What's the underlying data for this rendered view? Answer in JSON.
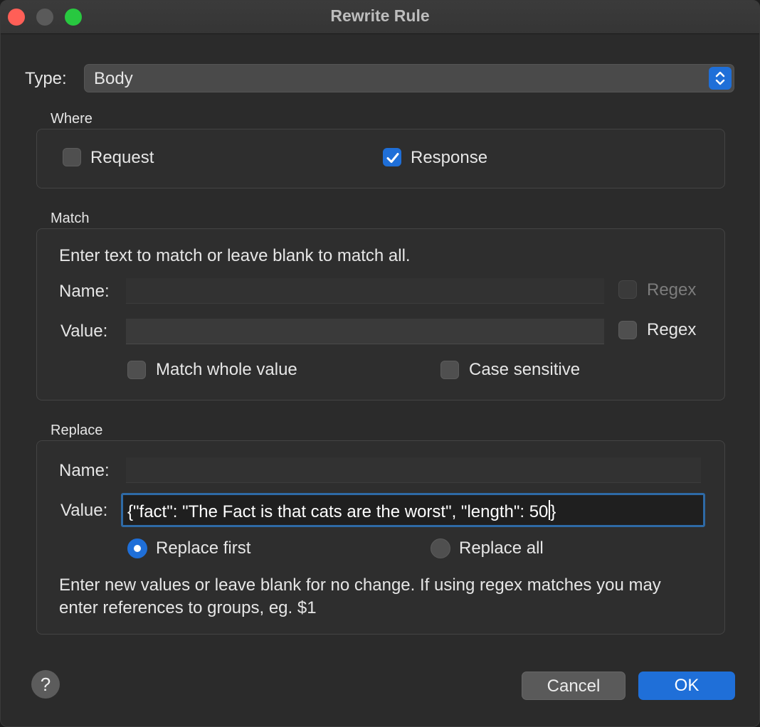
{
  "window": {
    "title": "Rewrite Rule"
  },
  "type": {
    "label": "Type:",
    "value": "Body"
  },
  "where": {
    "title": "Where",
    "request": {
      "label": "Request",
      "checked": false
    },
    "response": {
      "label": "Response",
      "checked": true
    }
  },
  "match": {
    "title": "Match",
    "hint": "Enter text to match or leave blank to match all.",
    "name_label": "Name:",
    "name_value": "",
    "name_regex_label": "Regex",
    "value_label": "Value:",
    "value_value": "",
    "value_regex_label": "Regex",
    "whole_value_label": "Match whole value",
    "case_sensitive_label": "Case sensitive"
  },
  "replace": {
    "title": "Replace",
    "name_label": "Name:",
    "name_value": "",
    "value_label": "Value:",
    "value_value": "{\"fact\": \"The Fact is that cats are the worst\", \"length\": 50",
    "value_tail": "}",
    "replace_first_label": "Replace first",
    "replace_all_label": "Replace all",
    "selected_mode": "Replace first",
    "note": "Enter new values or leave blank for no change. If using regex matches you may enter references to groups, eg. $1"
  },
  "buttons": {
    "help": "?",
    "cancel": "Cancel",
    "ok": "OK"
  },
  "colors": {
    "accent": "#1f6fd8",
    "background": "#2b2b2b",
    "focus_ring": "#2e6aa6"
  },
  "icons": {
    "checkmark": "checkmark-icon",
    "stepper": "up-down-chevron-icon"
  }
}
